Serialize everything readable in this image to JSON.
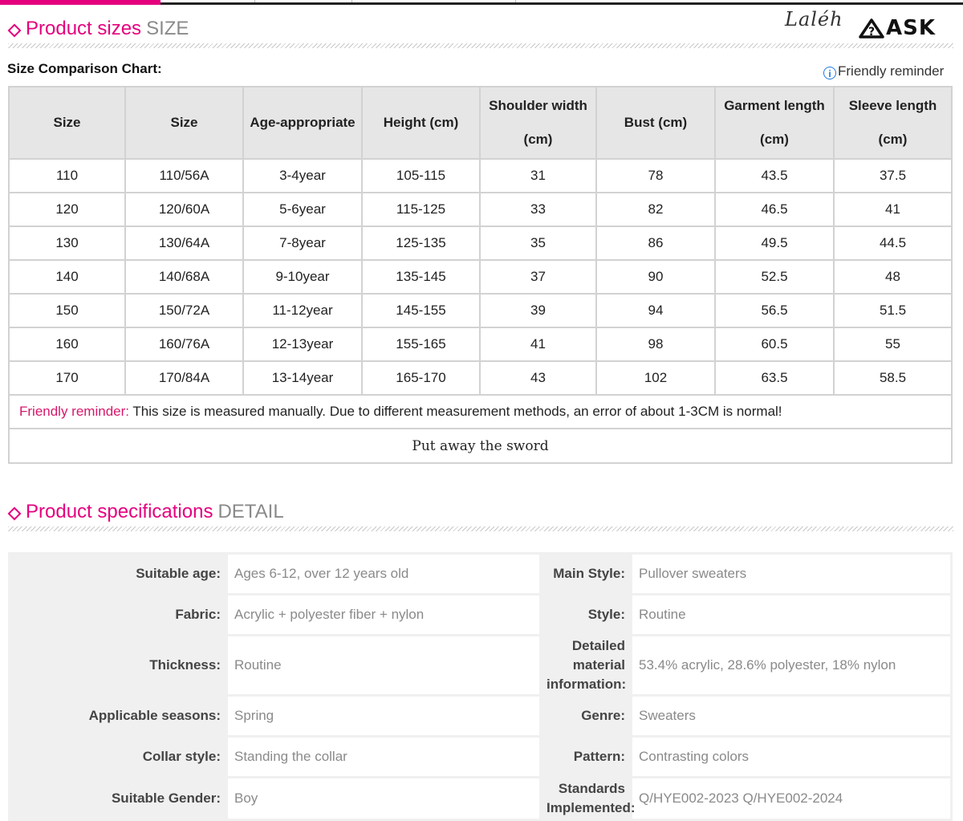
{
  "colors": {
    "accent": "#e5007e",
    "reminder_pink": "#d6186b",
    "header_gray": "#e6e6e6",
    "value_gray": "#8a8a8a"
  },
  "size_section": {
    "title": "Product sizes",
    "subtitle": "SIZE"
  },
  "logo": {
    "script": "Laléh",
    "brand": "ASK"
  },
  "chart_label": "Size Comparison Chart:",
  "friendly_reminder_link": "Friendly reminder",
  "size_table": {
    "headers": [
      {
        "line1": "Size",
        "line2": ""
      },
      {
        "line1": "Size",
        "line2": ""
      },
      {
        "line1": "Age-appropriate",
        "line2": ""
      },
      {
        "line1": "Height (cm)",
        "line2": ""
      },
      {
        "line1": "Shoulder width",
        "line2": "(cm)"
      },
      {
        "line1": "Bust (cm)",
        "line2": ""
      },
      {
        "line1": "Garment length",
        "line2": "(cm)"
      },
      {
        "line1": "Sleeve length",
        "line2": "(cm)"
      }
    ],
    "rows": [
      [
        "110",
        "110/56A",
        "3-4year",
        "105-115",
        "31",
        "78",
        "43.5",
        "37.5"
      ],
      [
        "120",
        "120/60A",
        "5-6year",
        "115-125",
        "33",
        "82",
        "46.5",
        "41"
      ],
      [
        "130",
        "130/64A",
        "7-8year",
        "125-135",
        "35",
        "86",
        "49.5",
        "44.5"
      ],
      [
        "140",
        "140/68A",
        "9-10year",
        "135-145",
        "37",
        "90",
        "52.5",
        "48"
      ],
      [
        "150",
        "150/72A",
        "11-12year",
        "145-155",
        "39",
        "94",
        "56.5",
        "51.5"
      ],
      [
        "160",
        "160/76A",
        "12-13year",
        "155-165",
        "41",
        "98",
        "60.5",
        "55"
      ],
      [
        "170",
        "170/84A",
        "13-14year",
        "165-170",
        "43",
        "102",
        "63.5",
        "58.5"
      ]
    ],
    "note_label": "Friendly reminder:",
    "note_text": " This size is measured manually. Due to different measurement methods, an error of about 1-3CM is normal!",
    "footer": "Put away  the  sword"
  },
  "spec_section": {
    "title": "Product specifications",
    "subtitle": "DETAIL"
  },
  "spec_table": [
    {
      "k1": "Suitable age:",
      "v1": "Ages 6-12, over 12 years old",
      "k2": "Main Style:",
      "v2": "Pullover sweaters"
    },
    {
      "k1": "Fabric:",
      "v1": "Acrylic + polyester fiber + nylon",
      "k2": "Style:",
      "v2": "Routine"
    },
    {
      "k1": "Thickness:",
      "v1": "Routine",
      "k2": "Detailed material information:",
      "v2": "53.4% acrylic, 28.6% polyester, 18% nylon"
    },
    {
      "k1": "Applicable seasons:",
      "v1": "Spring",
      "k2": "Genre:",
      "v2": "Sweaters"
    },
    {
      "k1": "Collar style:",
      "v1": "Standing the collar",
      "k2": "Pattern:",
      "v2": "Contrasting colors"
    },
    {
      "k1": "Suitable Gender:",
      "v1": "Boy",
      "k2": "Standards Implemented:",
      "v2": "Q/HYE002-2023 Q/HYE002-2024"
    }
  ]
}
